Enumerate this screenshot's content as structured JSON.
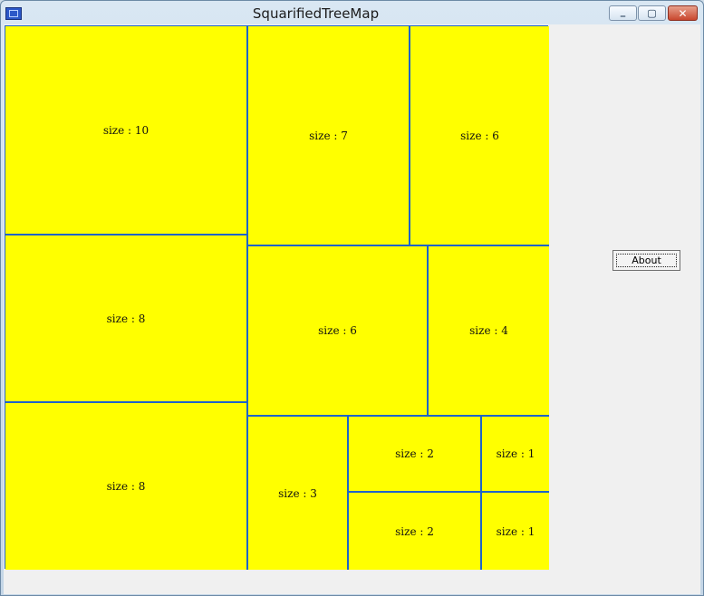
{
  "window": {
    "title": "SquarifiedTreeMap",
    "controls": {
      "minimize_icon": "minimize-icon",
      "maximize_icon": "maximize-icon",
      "close_icon": "close-icon"
    }
  },
  "colors": {
    "cell_fill": "#ffff00",
    "cell_border": "#1f64c8",
    "client_bg": "#f0f0f0"
  },
  "treemap": {
    "cells": [
      {
        "id": "a",
        "label": "size : 10",
        "value": 10
      },
      {
        "id": "b",
        "label": "size : 8",
        "value": 8
      },
      {
        "id": "c",
        "label": "size : 8",
        "value": 8
      },
      {
        "id": "d",
        "label": "size : 7",
        "value": 7
      },
      {
        "id": "e",
        "label": "size : 6",
        "value": 6
      },
      {
        "id": "f",
        "label": "size : 6",
        "value": 6
      },
      {
        "id": "g",
        "label": "size : 4",
        "value": 4
      },
      {
        "id": "h",
        "label": "size : 3",
        "value": 3
      },
      {
        "id": "i",
        "label": "size : 2",
        "value": 2
      },
      {
        "id": "j",
        "label": "size : 2",
        "value": 2
      },
      {
        "id": "k",
        "label": "size : 1",
        "value": 1
      },
      {
        "id": "l",
        "label": "size : 1",
        "value": 1
      }
    ]
  },
  "about_button": {
    "label": "About"
  }
}
